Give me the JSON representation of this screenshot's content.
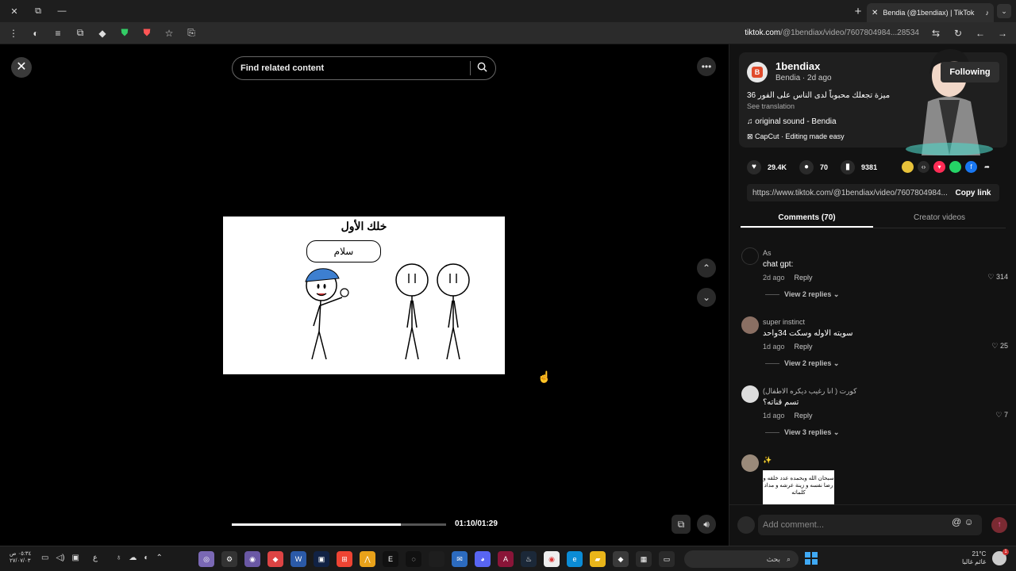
{
  "browser": {
    "tab_title": "Bendia (@1bendiax) | TikTok",
    "url_host": "tiktok.com",
    "url_path": "/@1bendiax/video/7607804984...28534",
    "win_controls": [
      "✕",
      "⧉",
      "—"
    ]
  },
  "video": {
    "search_placeholder": "Find related content",
    "frame_title": "خلك الأول",
    "bubble_text": "سلام",
    "time": "01:10/01:29",
    "progress_fraction": 0.79
  },
  "panel": {
    "username": "1bendiax",
    "user_line": "Bendia · 2d ago",
    "follow_label": "Following",
    "description": "36 ميزة تجعلك محبوباً لدى الناس على الفور",
    "see_translation": "See translation",
    "music": "original sound - Bendia",
    "capcut": "CapCut · Editing made easy",
    "likes": "29.4K",
    "comments_count": "70",
    "saves": "9381",
    "link": "https://www.tiktok.com/@1bendiax/video/7607804984...",
    "copy_label": "Copy link",
    "tab_comments": "Comments (70)",
    "tab_creator": "Creator videos",
    "reply_label": "Reply",
    "add_comment_placeholder": "Add comment..."
  },
  "comments": [
    {
      "name": "As",
      "text": "chat gpt:",
      "time": "2d ago",
      "likes": "314",
      "replies": "View 2 replies"
    },
    {
      "name": "super instinct",
      "text": "سويته الاوله وسكت 34واحد",
      "time": "1d ago",
      "likes": "25",
      "replies": "View 2 replies"
    },
    {
      "name": "كورت ( انا رغيب ديكره الاطفال)",
      "text": "تسم قناته؟",
      "time": "1d ago",
      "likes": "7",
      "replies": "View 3 replies"
    },
    {
      "name": "✨",
      "sticker": "سبحان الله وبحمده عدد خلقه و رضا نفسه و زينة عرشه و مداد كلماته"
    }
  ],
  "taskbar": {
    "clock_time": "٠٥:٣٤ ص",
    "clock_date": "٢٧/٠٧/٠٣",
    "search_label": "بحث",
    "weather_temp": "21°C",
    "weather_desc": "غائم غالبا",
    "badge": "1",
    "lang": "ع"
  },
  "colors": {
    "panel_bg": "#121212",
    "accent_red": "#fe2c55"
  }
}
